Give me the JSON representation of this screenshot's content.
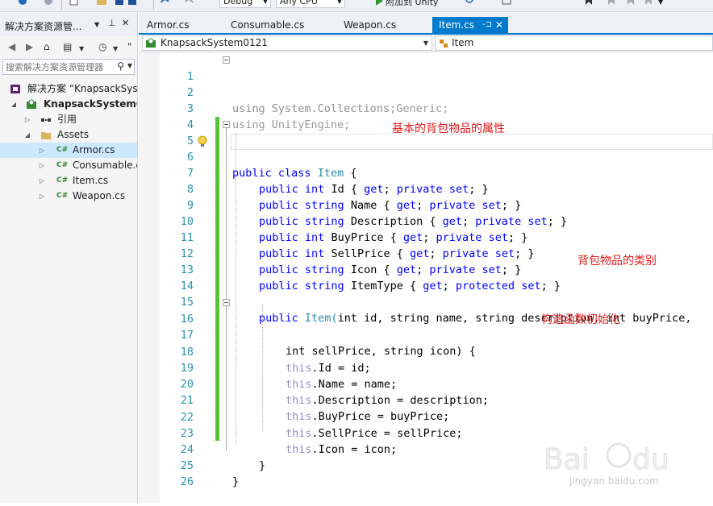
{
  "toolbar": {
    "config": "Debug",
    "platform": "Any CPU",
    "attach": "附加到 Unity"
  },
  "solution_explorer": {
    "title": "解决方案资源管...",
    "search_placeholder": "搜索解决方案资源管理器",
    "tree": [
      {
        "label": "解决方案 “KnapsackSys",
        "icon": "solution-icon",
        "bold": false
      },
      {
        "label": "KnapsackSystem01",
        "icon": "csharp-project-icon",
        "bold": true
      },
      {
        "label": "引用",
        "icon": "references-icon",
        "bold": false
      },
      {
        "label": "Assets",
        "icon": "folder-icon",
        "bold": false
      },
      {
        "label": "Armor.cs",
        "icon": "csharp-file-icon",
        "bold": false,
        "selected": true
      },
      {
        "label": "Consumable.c",
        "icon": "csharp-file-icon",
        "bold": false
      },
      {
        "label": "Item.cs",
        "icon": "csharp-file-icon",
        "bold": false
      },
      {
        "label": "Weapon.cs",
        "icon": "csharp-file-icon",
        "bold": false
      }
    ]
  },
  "tabs": [
    {
      "label": "Armor.cs",
      "active": false
    },
    {
      "label": "Consumable.cs",
      "active": false
    },
    {
      "label": "Weapon.cs",
      "active": false
    },
    {
      "label": "Item.cs",
      "active": true
    }
  ],
  "navbar": {
    "project": "KnapsackSystem0121",
    "type": "Item"
  },
  "code": {
    "line_numbers": [
      "1",
      "2",
      "3",
      "4",
      "5",
      "6",
      "7",
      "8",
      "9",
      "10",
      "11",
      "12",
      "13",
      "14",
      "15",
      "16",
      "17",
      "18",
      "19",
      "20",
      "21",
      "22",
      "23",
      "24",
      "25",
      "26"
    ],
    "l1": "using System.Collections;",
    "l2": "using System.Collections.Generic;",
    "l3": "using UnityEngine;",
    "l5a": "public class",
    "l5b": "Item",
    "l5c": "{",
    "props": [
      {
        "type": "int",
        "name": "Id",
        "setter": "private"
      },
      {
        "type": "string",
        "name": "Name",
        "setter": "private"
      },
      {
        "type": "string",
        "name": "Description",
        "setter": "private"
      },
      {
        "type": "int",
        "name": "BuyPrice",
        "setter": "private"
      },
      {
        "type": "int",
        "name": "SellPrice",
        "setter": "private"
      },
      {
        "type": "string",
        "name": "Icon",
        "setter": "private"
      },
      {
        "type": "string",
        "name": "ItemType",
        "setter": "protected"
      }
    ],
    "ctor1_name": "Item(",
    "ctor1_params": "int id, string name, string description, int buyPrice,",
    "ctor2_params": "int sellPrice, string icon) {",
    "assigns": [
      {
        "field": ".Id = id;"
      },
      {
        "field": ".Name = name;"
      },
      {
        "field": ".Description = description;"
      },
      {
        "field": ".BuyPrice = buyPrice;"
      },
      {
        "field": ".SellPrice = sellPrice;"
      },
      {
        "field": ".Icon = icon;"
      }
    ],
    "this_kw": "this",
    "close_inner": "}",
    "close_outer": "}"
  },
  "annotations": {
    "a1": "基本的背包物品的属性",
    "a2": "背包物品的类别",
    "a3": "构造函数初始化"
  },
  "watermark": {
    "text": "jingyan.baidu.com"
  }
}
